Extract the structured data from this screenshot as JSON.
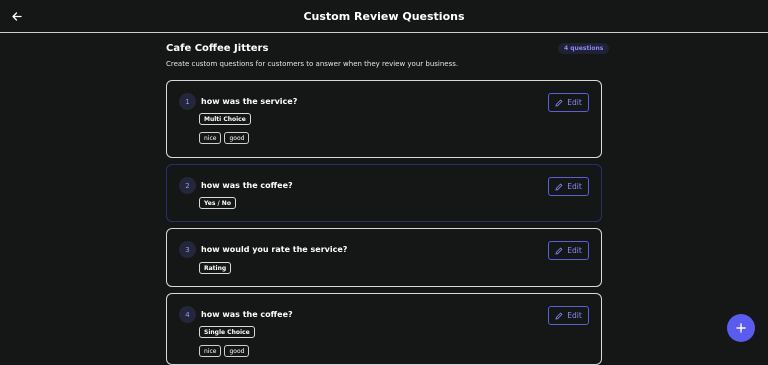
{
  "header": {
    "title": "Custom Review Questions"
  },
  "business": {
    "name": "Cafe Coffee Jitters",
    "question_count": "4 questions",
    "subtitle": "Create custom questions for customers to answer when they review your business."
  },
  "questions": [
    {
      "number": "1",
      "text": "how was the service?",
      "type": "Multi Choice",
      "options": [
        "nice",
        "good"
      ],
      "edit_label": "Edit"
    },
    {
      "number": "2",
      "text": "how was the coffee?",
      "type": "Yes / No",
      "options": [],
      "edit_label": "Edit"
    },
    {
      "number": "3",
      "text": "how would you rate the service?",
      "type": "Rating",
      "options": [],
      "edit_label": "Edit"
    },
    {
      "number": "4",
      "text": "how was the coffee?",
      "type": "Single Choice",
      "options": [
        "nice",
        "good"
      ],
      "edit_label": "Edit"
    }
  ],
  "icons": {
    "back": "arrow-left-icon",
    "edit": "pencil-icon",
    "add": "plus-icon"
  },
  "colors": {
    "accent": "#5a5cf0",
    "accent_text": "#8b87ff",
    "background": "#141716"
  }
}
